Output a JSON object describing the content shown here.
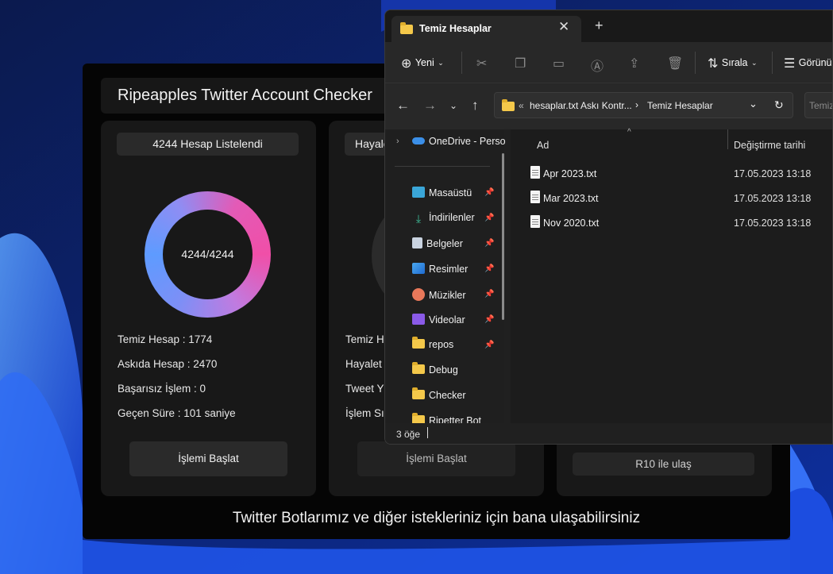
{
  "checker": {
    "title": "Ripeapples Twitter Account Checker",
    "card1": {
      "header": "4244 Hesap Listelendi",
      "progress_text": "4244/4244",
      "stats": [
        "Temiz Hesap : 1774",
        "Askıda Hesap : 2470",
        "Başarısız İşlem : 0",
        "Geçen Süre : 101 saniye"
      ],
      "button": "İşlemi Başlat"
    },
    "card2": {
      "header": "Hayalet",
      "stats": [
        "Temiz H",
        "Hayalet",
        "Tweet Y",
        "İşlem Sı"
      ],
      "button": "İşlemi Başlat"
    },
    "card3": {
      "button": "R10 ile ulaş"
    },
    "footer": "Twitter Botlarımız ve diğer istekleriniz için bana ulaşabilirsiniz"
  },
  "explorer": {
    "tab_title": "Temiz Hesaplar",
    "tab_close": "✕",
    "new_tab": "+",
    "commands": {
      "new_label": "Yeni",
      "sort_label": "Sırala",
      "view_label": "Görünü"
    },
    "address": {
      "chevrons": "«",
      "parent": "hesaplar.txt Askı Kontr...",
      "separator": "›",
      "current": "Temiz Hesaplar"
    },
    "search_placeholder": "Temiz",
    "nav_pane": {
      "onedrive": "OneDrive - Perso",
      "items": [
        {
          "label": "Masaüstü",
          "pinned": true
        },
        {
          "label": "İndirilenler",
          "pinned": true
        },
        {
          "label": "Belgeler",
          "pinned": true
        },
        {
          "label": "Resimler",
          "pinned": true
        },
        {
          "label": "Müzikler",
          "pinned": true
        },
        {
          "label": "Videolar",
          "pinned": true
        },
        {
          "label": "repos",
          "pinned": true
        },
        {
          "label": "Debug",
          "pinned": false
        },
        {
          "label": "Checker",
          "pinned": false
        },
        {
          "label": "Ripetter Bot",
          "pinned": false
        }
      ]
    },
    "columns": {
      "name": "Ad",
      "modified": "Değiştirme tarihi"
    },
    "files": [
      {
        "name": "Apr 2023.txt",
        "modified": "17.05.2023 13:18"
      },
      {
        "name": "Mar 2023.txt",
        "modified": "17.05.2023 13:18"
      },
      {
        "name": "Nov 2020.txt",
        "modified": "17.05.2023 13:18"
      }
    ],
    "status": "3 öğe"
  }
}
